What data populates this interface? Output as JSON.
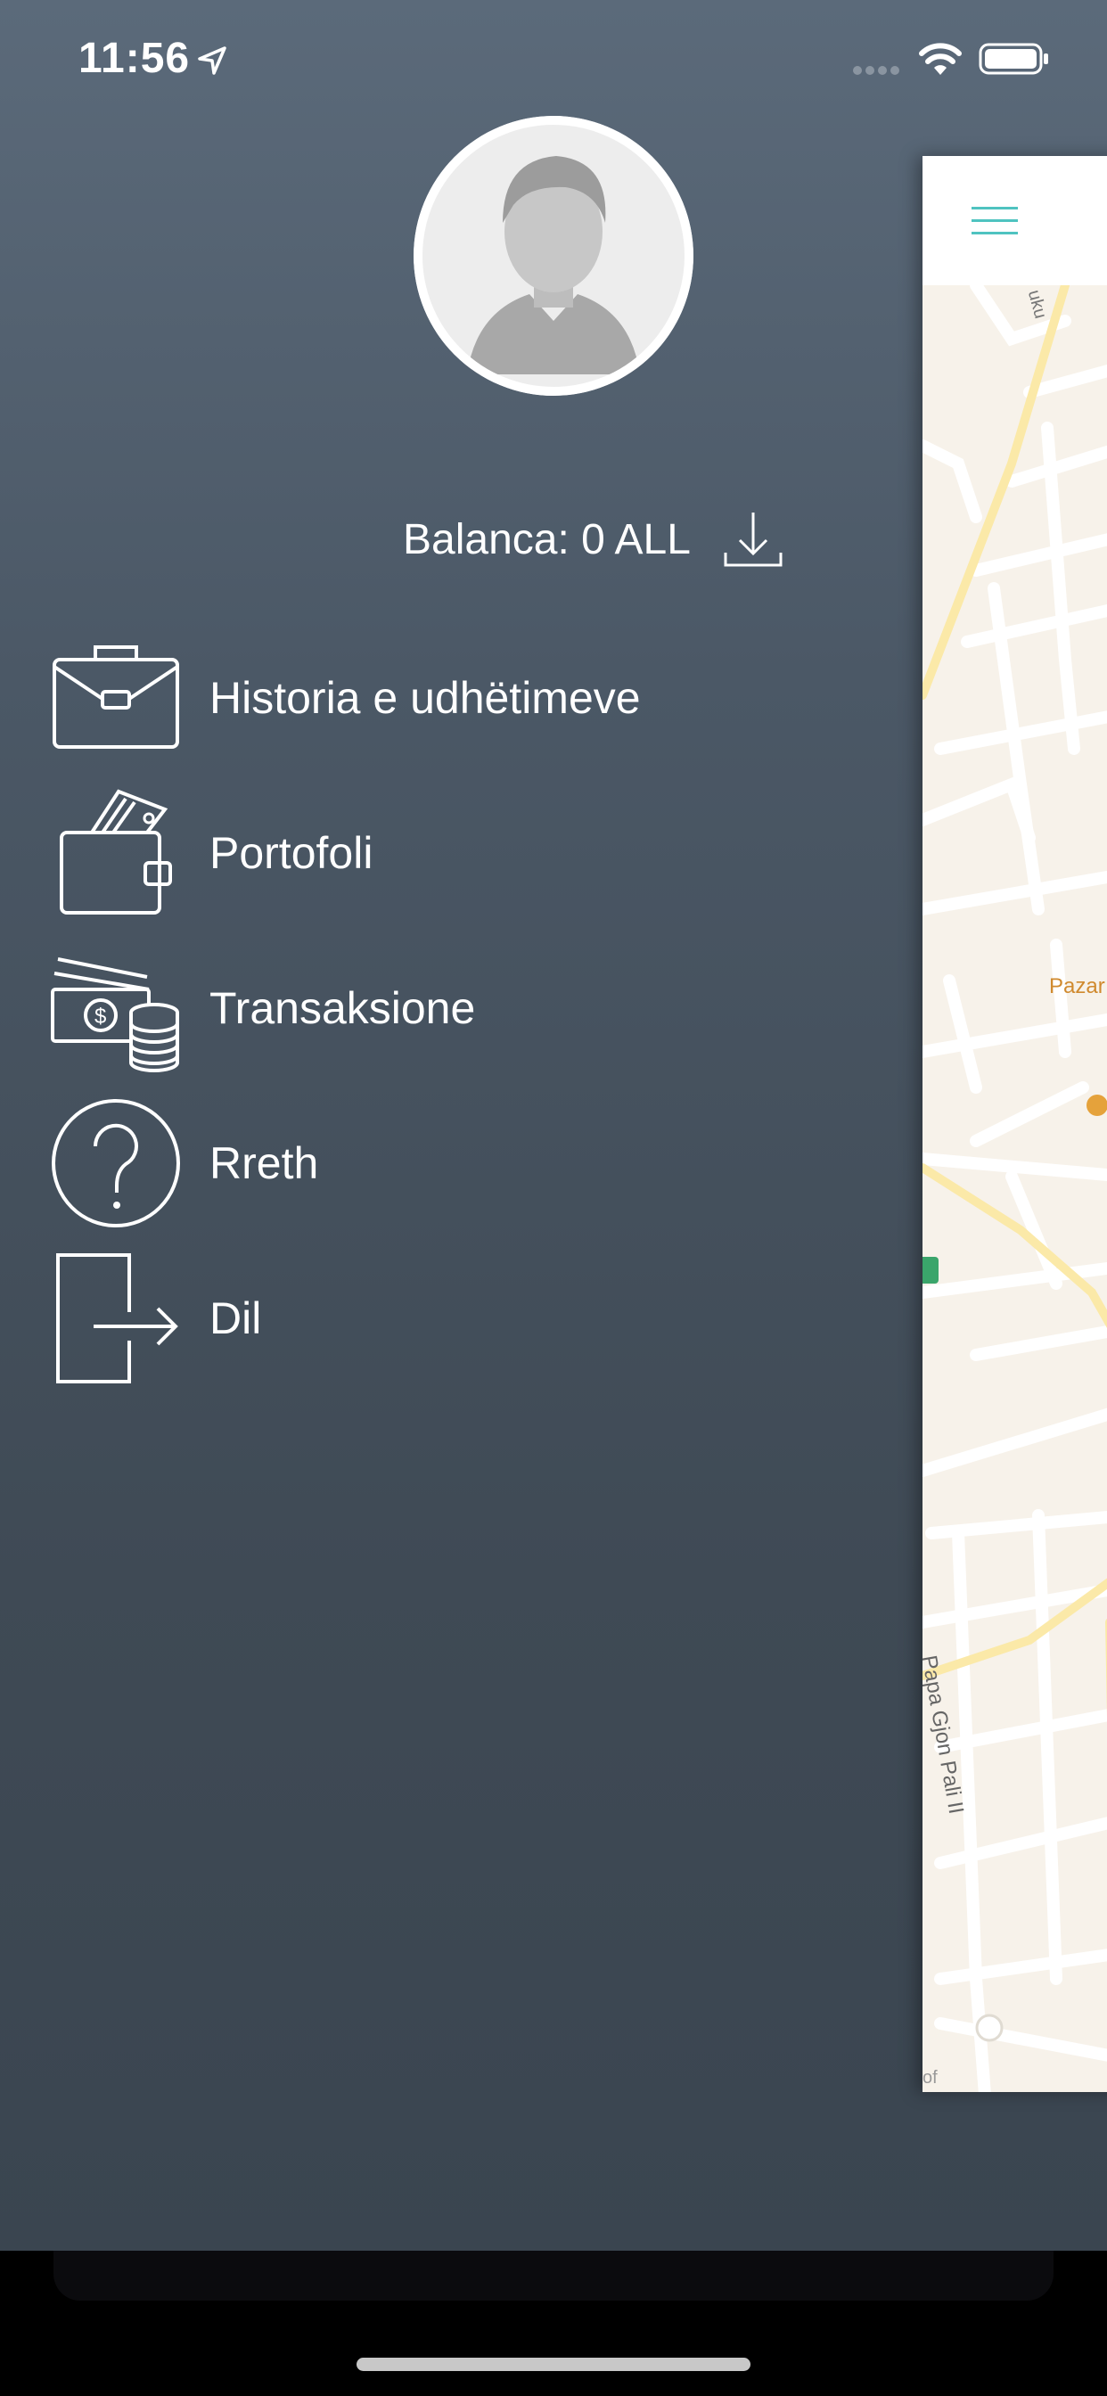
{
  "status_bar": {
    "time": "11:56"
  },
  "profile": {
    "balance_text": "Balanca: 0 ALL"
  },
  "menu": {
    "items": [
      {
        "label": "Historia e udhëtimeve",
        "icon": "briefcase-icon"
      },
      {
        "label": "Portofoli",
        "icon": "wallet-icon"
      },
      {
        "label": "Transaksione",
        "icon": "money-icon"
      },
      {
        "label": "Rreth",
        "icon": "help-icon"
      },
      {
        "label": "Dil",
        "icon": "logout-icon"
      }
    ]
  },
  "map": {
    "poi_label": "Pazar",
    "street_label": "Papa Gjon Pali II",
    "street_small": "uku",
    "attribution": "of"
  },
  "colors": {
    "accent": "#4fc3c0",
    "map_background": "#f7f2ea",
    "road_major": "#fbe9a8",
    "poi": "#d08a2e"
  }
}
